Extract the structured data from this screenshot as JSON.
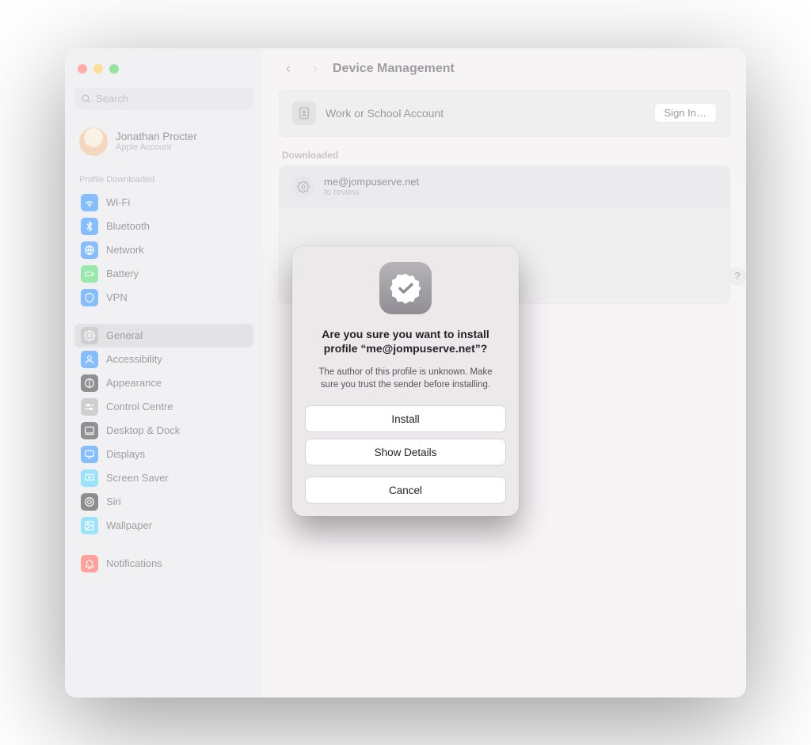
{
  "header": {
    "title": "Device Management"
  },
  "search": {
    "placeholder": "Search"
  },
  "account": {
    "name": "Jonathan Procter",
    "sub": "Apple Account"
  },
  "sidebar": {
    "section_label": "Profile Downloaded",
    "items": [
      {
        "label": "Wi-Fi",
        "icon": "wifi",
        "color": "#0a7aff"
      },
      {
        "label": "Bluetooth",
        "icon": "bluetooth",
        "color": "#0a7aff"
      },
      {
        "label": "Network",
        "icon": "globe",
        "color": "#0a7aff"
      },
      {
        "label": "Battery",
        "icon": "battery",
        "color": "#32d158"
      },
      {
        "label": "VPN",
        "icon": "shield",
        "color": "#0a7aff"
      }
    ],
    "items2": [
      {
        "label": "General",
        "icon": "gear",
        "color": "#9e9da2",
        "selected": true
      },
      {
        "label": "Accessibility",
        "icon": "person",
        "color": "#0a7aff"
      },
      {
        "label": "Appearance",
        "icon": "appearance",
        "color": "#201f22"
      },
      {
        "label": "Control Centre",
        "icon": "sliders",
        "color": "#9e9da2"
      },
      {
        "label": "Desktop & Dock",
        "icon": "dock",
        "color": "#201f22"
      },
      {
        "label": "Displays",
        "icon": "display",
        "color": "#0a7aff"
      },
      {
        "label": "Screen Saver",
        "icon": "screensaver",
        "color": "#34c7f7"
      },
      {
        "label": "Siri",
        "icon": "siri",
        "color": "#1d1c1f"
      },
      {
        "label": "Wallpaper",
        "icon": "wallpaper",
        "color": "#34c7f7"
      }
    ],
    "items3": [
      {
        "label": "Notifications",
        "icon": "bell",
        "color": "#ff4539"
      }
    ]
  },
  "work_school": {
    "label": "Work or School Account",
    "button": "Sign In…"
  },
  "downloaded": {
    "header": "Downloaded",
    "profile_title": "me@jompuserve.net",
    "profile_sub": "to review."
  },
  "help": "?",
  "modal": {
    "title": "Are you sure you want to install profile “me@jompuserve.net”?",
    "subtitle": "The author of this profile is unknown. Make sure you trust the sender before installing.",
    "install": "Install",
    "details": "Show Details",
    "cancel": "Cancel"
  }
}
